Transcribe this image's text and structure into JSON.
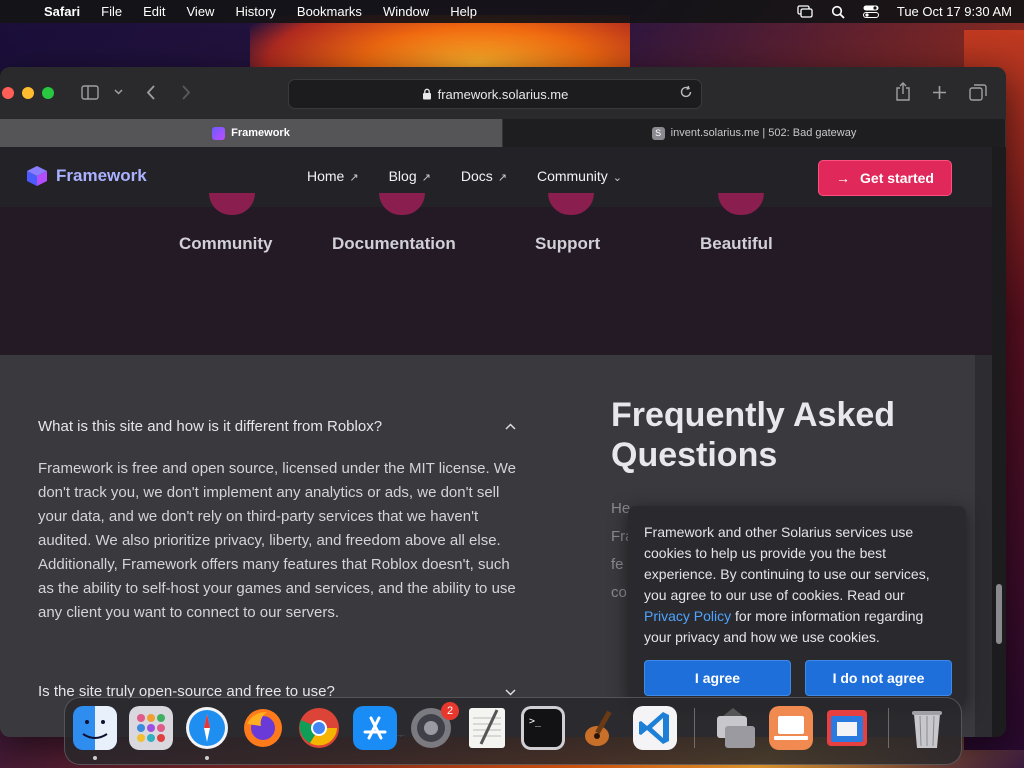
{
  "menubar": {
    "app": "Safari",
    "items": [
      "File",
      "Edit",
      "View",
      "History",
      "Bookmarks",
      "Window",
      "Help"
    ],
    "datetime": "Tue Oct 17  9:30 AM"
  },
  "browser": {
    "url": "framework.solarius.me",
    "tabs": [
      {
        "label": "Framework",
        "favicon": "framework-cube"
      },
      {
        "label": "invent.solarius.me | 502: Bad gateway",
        "favicon": "S"
      }
    ]
  },
  "site": {
    "brand": "Framework",
    "nav": [
      "Home",
      "Blog",
      "Docs",
      "Community"
    ],
    "cta": "Get started",
    "features": [
      "Community",
      "Documentation",
      "Support",
      "Beautiful"
    ],
    "faq": {
      "title_line1": "Frequently Asked",
      "title_line2": "Questions",
      "subtitle_line1": "He",
      "subtitle_line2": "Fra",
      "subtitle_line3": "fe",
      "subtitle_line4": "co",
      "q1": "What is this site and how is it different from Roblox?",
      "a1": "Framework is free and open source, licensed under the MIT license. We don't track you, we don't implement any analytics or ads, we don't sell your data, and we don't rely on third-party services that we haven't audited. We also prioritize privacy, liberty, and freedom above all else. Additionally, Framework offers many features that Roblox doesn't, such as the ability to self-host your games and services, and the ability to use any client you want to connect to our servers.",
      "q2": "Is the site truly open-source and free to use?"
    }
  },
  "cookie": {
    "text_before": "Framework and other Solarius services use cookies to help us provide you the best experience. By continuing to use our services, you agree to our use of cookies. Read our",
    "link": "Privacy Policy",
    "text_after": "for more information regarding your privacy and how we use cookies.",
    "agree": "I agree",
    "disagree": "I do not agree"
  },
  "dock": {
    "settings_badge": "2"
  }
}
